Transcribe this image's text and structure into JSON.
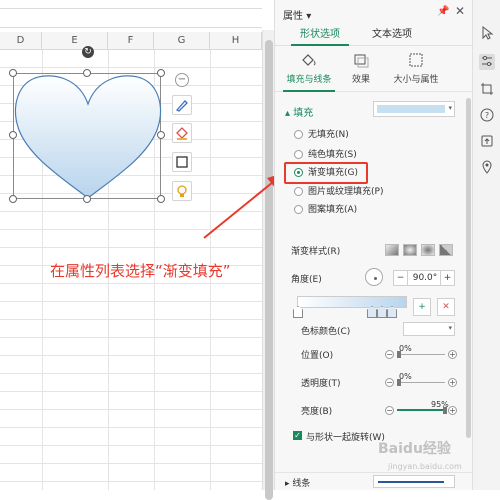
{
  "sheet": {
    "columns": [
      "D",
      "E",
      "F",
      "G",
      "H"
    ],
    "shape_toolbar": [
      "collapse",
      "pen-icon",
      "fill-bucket-icon",
      "outline-icon",
      "bulb-icon"
    ]
  },
  "annotation": {
    "text": "在属性列表选择“渐变填充”",
    "color": "#e8392c"
  },
  "panel": {
    "title": "属性",
    "title_caret": "▾",
    "top_tabs": [
      "形状选项",
      "文本选项"
    ],
    "active_top_tab": 0,
    "sub_tabs": [
      "填充与线条",
      "效果",
      "大小与属性"
    ],
    "active_sub_tab": 0,
    "fill": {
      "section_title": "填充",
      "options": [
        "无填充(N)",
        "纯色填充(S)",
        "渐变填充(G)",
        "图片或纹理填充(P)",
        "图案填充(A)"
      ],
      "selected_index": 2
    },
    "gradient": {
      "style_label": "渐变样式(R)",
      "angle_label": "角度(E)",
      "angle_value": "90.0°",
      "stop_color_label": "色标颜色(C)",
      "position_label": "位置(O)",
      "position_value": "0%",
      "transparency_label": "透明度(T)",
      "transparency_value": "0%",
      "brightness_label": "亮度(B)",
      "brightness_value": "95%"
    },
    "rotate_with_shape": "与形状一起旋转(W)",
    "line_section_title": "线条"
  },
  "colors": {
    "accent": "#1a8a5e",
    "highlight": "#e8392c",
    "heart_top": "#ffffff",
    "heart_bottom": "#b8d4ec"
  },
  "watermark": {
    "main": "Baidu经验",
    "sub": "jingyan.baidu.com"
  }
}
